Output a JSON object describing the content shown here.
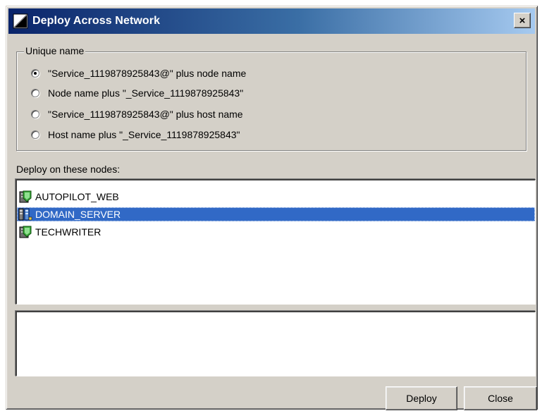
{
  "window": {
    "title": "Deploy Across Network",
    "close_glyph": "×",
    "title_icon": "deploy-app-icon"
  },
  "unique_name": {
    "legend": "Unique name",
    "selected_index": 0,
    "options": [
      {
        "label": "\"Service_1119878925843@\" plus node name"
      },
      {
        "label": "Node name plus \"_Service_1119878925843\""
      },
      {
        "label": "\"Service_1119878925843@\" plus host name"
      },
      {
        "label": "Host name plus \"_Service_1119878925843\""
      }
    ]
  },
  "nodes": {
    "label": "Deploy on these nodes:",
    "selected_index": 1,
    "items": [
      {
        "label": "AUTOPILOT_WEB",
        "icon": "server-node-icon"
      },
      {
        "label": "DOMAIN_SERVER",
        "icon": "domain-server-icon"
      },
      {
        "label": "TECHWRITER",
        "icon": "server-node-icon"
      }
    ]
  },
  "output": {
    "text": ""
  },
  "buttons": {
    "deploy": "Deploy",
    "close": "Close"
  },
  "colors": {
    "dialog_face": "#d4d0c8",
    "titlebar_start": "#0a246a",
    "titlebar_end": "#a6caf0",
    "selection": "#3169c6"
  }
}
